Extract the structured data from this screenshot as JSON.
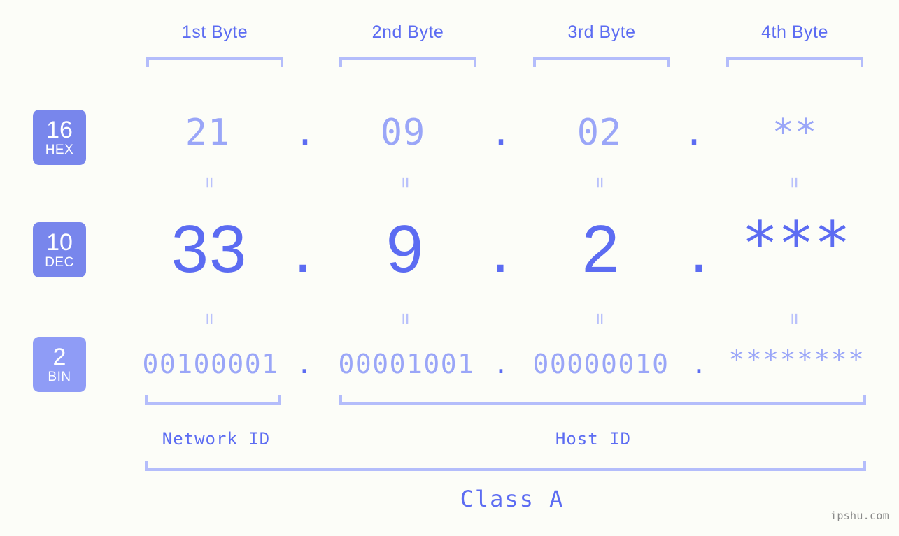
{
  "page": {
    "background_color": "#fcfdf8",
    "accent_color": "#5c6cf2",
    "muted_accent_color": "#9aa6f8",
    "bracket_color": "#b4bdfb",
    "watermark": "ipshu.com"
  },
  "byte_headers": [
    {
      "label": "1st Byte"
    },
    {
      "label": "2nd Byte"
    },
    {
      "label": "3rd Byte"
    },
    {
      "label": "4th Byte"
    }
  ],
  "bases": [
    {
      "number": "16",
      "abbr": "HEX",
      "color": "#7886ec"
    },
    {
      "number": "10",
      "abbr": "DEC",
      "color": "#7886ec"
    },
    {
      "number": "2",
      "abbr": "BIN",
      "color": "#8f9cf6"
    }
  ],
  "rows": {
    "hex": {
      "values": [
        "21",
        "09",
        "02",
        "**"
      ],
      "separator": "."
    },
    "dec": {
      "values": [
        "33",
        "9",
        "2",
        "***"
      ],
      "separator": "."
    },
    "bin": {
      "values": [
        "00100001",
        "00001001",
        "00000010",
        "********"
      ],
      "separator": "."
    }
  },
  "equals_separators": {
    "glyph": "=",
    "count_per_row": 4
  },
  "id_labels": [
    {
      "label": "Network ID"
    },
    {
      "label": "Host ID"
    }
  ],
  "class_label": {
    "label": "Class A"
  }
}
